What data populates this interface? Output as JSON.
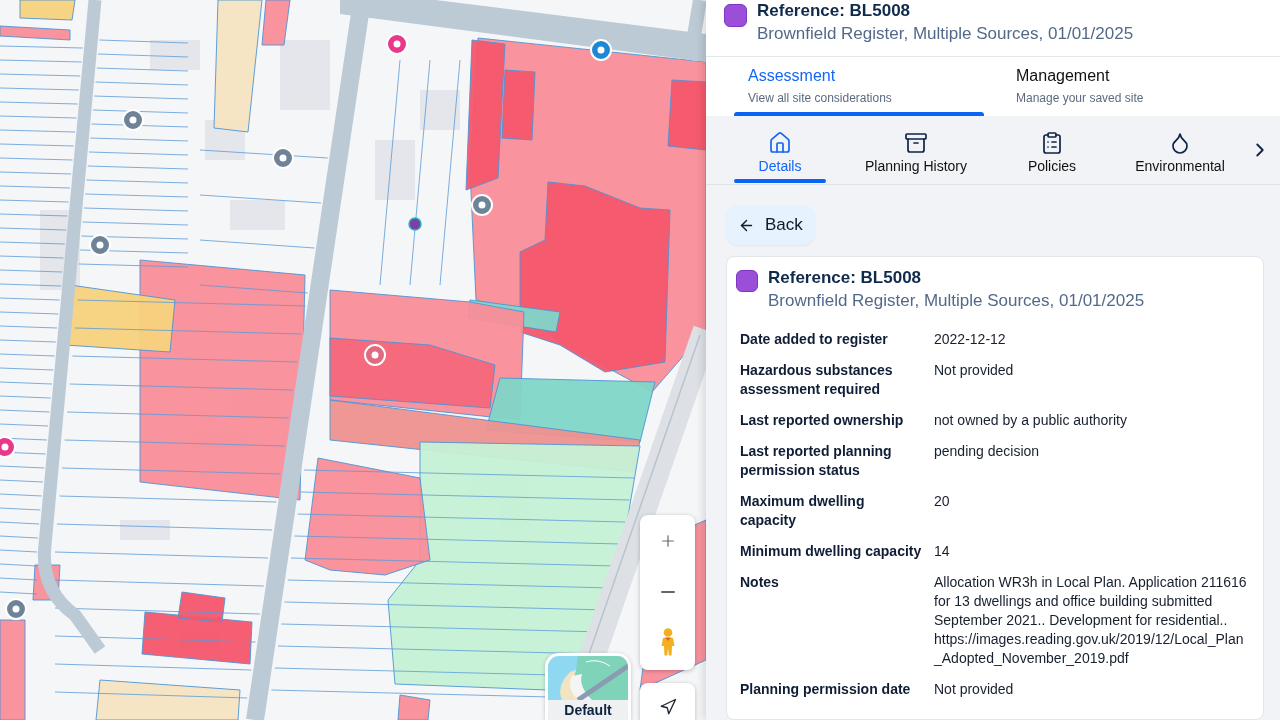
{
  "map": {
    "layer_switcher": {
      "label": "Default"
    }
  },
  "site": {
    "title": "Reference: BL5008",
    "subtitle": "Brownfield Register, Multiple Sources, 01/01/2025"
  },
  "tabs": [
    {
      "label": "Assessment",
      "description": "View all site considerations",
      "selected": true
    },
    {
      "label": "Management",
      "description": "Manage your saved site",
      "selected": false
    }
  ],
  "subtabs": [
    {
      "label": "Details",
      "selected": true
    },
    {
      "label": "Planning History",
      "selected": false
    },
    {
      "label": "Policies",
      "selected": false
    },
    {
      "label": "Environmental",
      "selected": false
    }
  ],
  "back_button": {
    "label": "Back"
  },
  "card": {
    "title": "Reference: BL5008",
    "subtitle": "Brownfield Register, Multiple Sources, 01/01/2025",
    "fields": [
      {
        "label": "Date added to register",
        "value": "2022-12-12"
      },
      {
        "label": "Hazardous substances assessment required",
        "value": "Not provided"
      },
      {
        "label": "Last reported ownership",
        "value": "not owned by a public authority"
      },
      {
        "label": "Last reported planning permission status",
        "value": "pending decision"
      },
      {
        "label": "Maximum dwelling capacity",
        "value": "20"
      },
      {
        "label": "Minimum dwelling capacity",
        "value": "14"
      },
      {
        "label": "Notes",
        "value": "Allocation WR3h in Local Plan. Application 211616 for 13 dwellings and office building submitted September 2021.. Development for residential.. https://images.reading.gov.uk/2019/12/Local_Plan_Adopted_November_2019.pdf"
      },
      {
        "label": "Planning permission date",
        "value": "Not provided"
      }
    ]
  }
}
